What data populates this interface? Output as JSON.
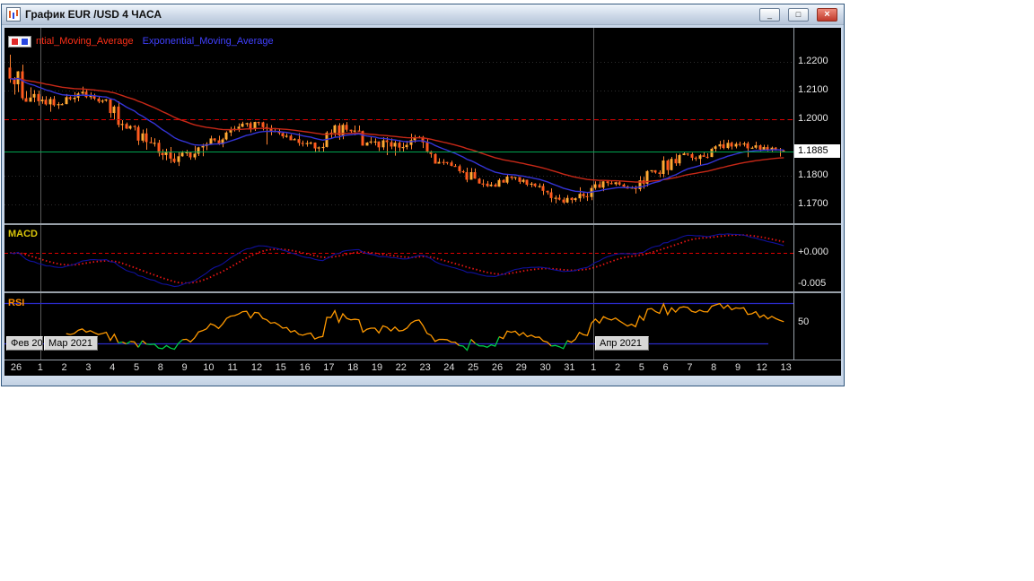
{
  "window": {
    "title": "График EUR /USD  4 ЧАСА",
    "controls": {
      "minimize": "_",
      "maximize": "□",
      "close": "×"
    }
  },
  "legend": {
    "red_label": "ntial_Moving_Average",
    "blue_label": "Exponential_Moving_Average"
  },
  "panes": {
    "macd_label": "MACD",
    "rsi_label": "RSI"
  },
  "colors": {
    "candle_up": "#ffaa33",
    "candle_down": "#ff5a1e",
    "candle_wick": "#ff8330",
    "ema_fast_blue": "#3434d6",
    "ema_slow_red": "#c62817",
    "macd_line": "#10109e",
    "macd_signal": "#e81414",
    "rsi_line": "#ff9900",
    "rsi_overbought": "#ff00ff",
    "rsi_oversold": "#00cc44",
    "level_blue": "#2a2ac8",
    "dashed_red": "#e00000",
    "green_line": "#00a550",
    "grid_gray": "#5a5a5a"
  },
  "chart_data": {
    "type": "candlestick",
    "symbol": "EUR /USD",
    "timeframe": "4 ЧАСА",
    "price_axis": {
      "ticks": [
        "1.2200",
        "1.2100",
        "1.2000",
        "1.1800",
        "1.1700"
      ],
      "ylim": [
        1.165,
        1.226
      ]
    },
    "macd_axis": {
      "ticks": [
        "+0.000",
        "-0.005"
      ]
    },
    "rsi_axis": {
      "ticks": [
        "50"
      ],
      "levels": [
        70,
        30
      ]
    },
    "levels": {
      "dashed_red": 1.2,
      "green_line": 1.1885,
      "last_price_label": "1.1885"
    },
    "months": [
      "Фев 20",
      "Мар 2021",
      "Апр 2021"
    ],
    "month_breaks": [
      1,
      24
    ],
    "days": [
      {
        "label": "26",
        "o": 1.218,
        "h": 1.2225,
        "l": 1.206,
        "c": 1.2075
      },
      {
        "label": "1",
        "o": 1.2075,
        "h": 1.2101,
        "l": 1.2025,
        "c": 1.2048
      },
      {
        "label": "2",
        "o": 1.2048,
        "h": 1.2094,
        "l": 1.2035,
        "c": 1.2089
      },
      {
        "label": "3",
        "o": 1.2089,
        "h": 1.2113,
        "l": 1.2055,
        "c": 1.2064
      },
      {
        "label": "4",
        "o": 1.2064,
        "h": 1.207,
        "l": 1.196,
        "c": 1.1966
      },
      {
        "label": "5",
        "o": 1.1966,
        "h": 1.1978,
        "l": 1.1892,
        "c": 1.1915
      },
      {
        "label": "8",
        "o": 1.1915,
        "h": 1.1932,
        "l": 1.1845,
        "c": 1.1849
      },
      {
        "label": "9",
        "o": 1.1849,
        "h": 1.1905,
        "l": 1.1835,
        "c": 1.19
      },
      {
        "label": "10",
        "o": 1.19,
        "h": 1.1941,
        "l": 1.1869,
        "c": 1.1928
      },
      {
        "label": "11",
        "o": 1.1928,
        "h": 1.199,
        "l": 1.1925,
        "c": 1.1985
      },
      {
        "label": "12",
        "o": 1.1985,
        "h": 1.199,
        "l": 1.191,
        "c": 1.1955
      },
      {
        "label": "15",
        "o": 1.1955,
        "h": 1.1968,
        "l": 1.1925,
        "c": 1.1929
      },
      {
        "label": "16",
        "o": 1.1929,
        "h": 1.195,
        "l": 1.1882,
        "c": 1.19
      },
      {
        "label": "17",
        "o": 1.19,
        "h": 1.1985,
        "l": 1.1885,
        "c": 1.1979
      },
      {
        "label": "18",
        "o": 1.1979,
        "h": 1.1989,
        "l": 1.1906,
        "c": 1.1917
      },
      {
        "label": "19",
        "o": 1.1917,
        "h": 1.1936,
        "l": 1.1873,
        "c": 1.1903
      },
      {
        "label": "22",
        "o": 1.1903,
        "h": 1.1948,
        "l": 1.1871,
        "c": 1.1934
      },
      {
        "label": "23",
        "o": 1.1934,
        "h": 1.194,
        "l": 1.1843,
        "c": 1.1849
      },
      {
        "label": "24",
        "o": 1.1849,
        "h": 1.1859,
        "l": 1.1809,
        "c": 1.1813
      },
      {
        "label": "25",
        "o": 1.1813,
        "h": 1.1829,
        "l": 1.1761,
        "c": 1.1764
      },
      {
        "label": "26",
        "o": 1.1764,
        "h": 1.1805,
        "l": 1.1762,
        "c": 1.1793
      },
      {
        "label": "29",
        "o": 1.1793,
        "h": 1.1796,
        "l": 1.176,
        "c": 1.1764
      },
      {
        "label": "30",
        "o": 1.1764,
        "h": 1.1774,
        "l": 1.1704,
        "c": 1.1717
      },
      {
        "label": "31",
        "o": 1.1717,
        "h": 1.176,
        "l": 1.1702,
        "c": 1.1729
      },
      {
        "label": "1",
        "o": 1.1729,
        "h": 1.1781,
        "l": 1.1712,
        "c": 1.1775
      },
      {
        "label": "2",
        "o": 1.1775,
        "h": 1.1784,
        "l": 1.1755,
        "c": 1.176
      },
      {
        "label": "5",
        "o": 1.176,
        "h": 1.182,
        "l": 1.1738,
        "c": 1.1812
      },
      {
        "label": "6",
        "o": 1.1812,
        "h": 1.1878,
        "l": 1.1795,
        "c": 1.1873
      },
      {
        "label": "7",
        "o": 1.1873,
        "h": 1.1885,
        "l": 1.1838,
        "c": 1.1867
      },
      {
        "label": "8",
        "o": 1.1867,
        "h": 1.1927,
        "l": 1.1861,
        "c": 1.1916
      },
      {
        "label": "9",
        "o": 1.1916,
        "h": 1.192,
        "l": 1.1866,
        "c": 1.1899
      },
      {
        "label": "12",
        "o": 1.1899,
        "h": 1.192,
        "l": 1.1882,
        "c": 1.1893
      },
      {
        "label": "13",
        "o": 1.1893,
        "h": 1.1898,
        "l": 1.1868,
        "c": 1.1885,
        "candles": 2
      }
    ]
  }
}
